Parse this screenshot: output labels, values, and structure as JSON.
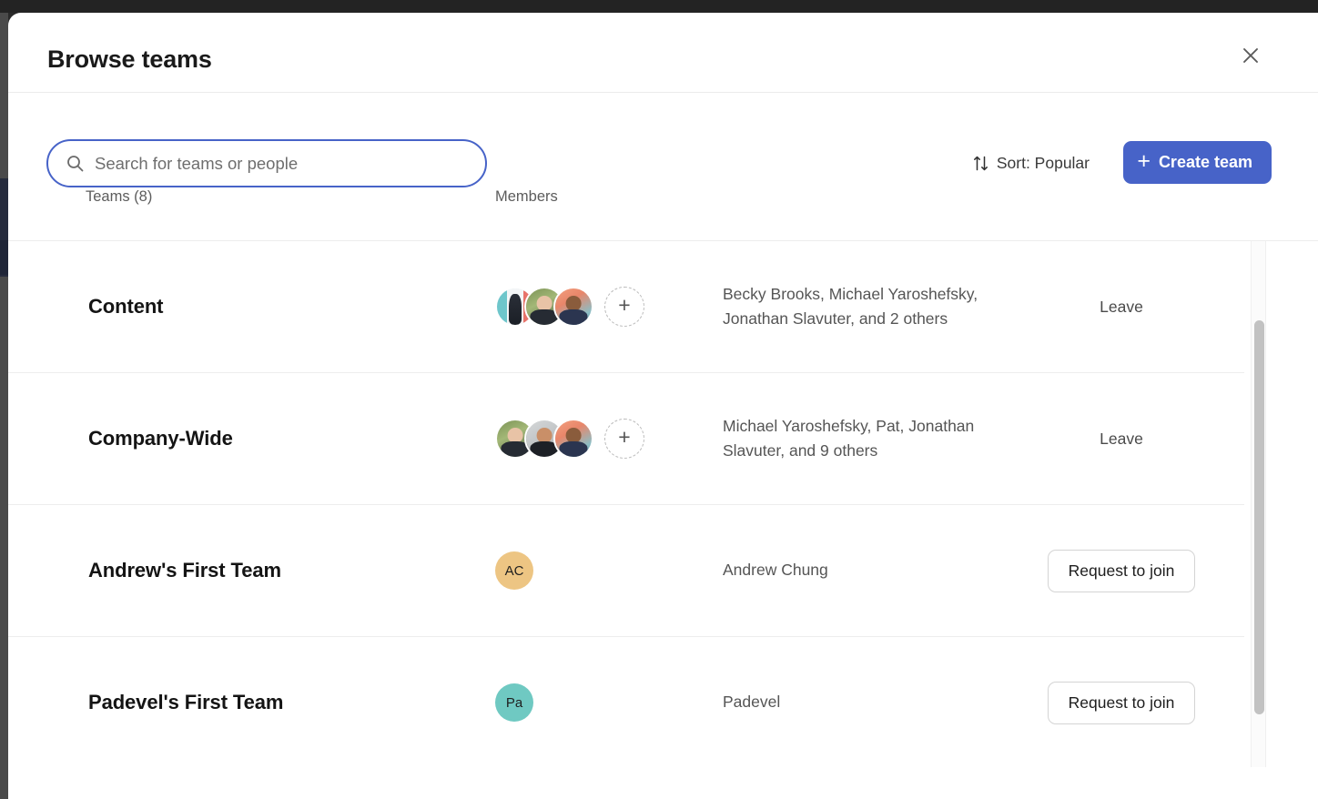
{
  "modal": {
    "title": "Browse teams",
    "close_icon": "close-icon"
  },
  "search": {
    "placeholder": "Search for teams or people",
    "value": "",
    "icon": "search-icon"
  },
  "toolbar": {
    "sort_label": "Sort: Popular",
    "sort_icon": "sort-arrows-icon",
    "create_label": "Create team",
    "create_plus": "+",
    "accent_color": "#4763c8"
  },
  "table": {
    "header_teams": "Teams (8)",
    "header_members": "Members"
  },
  "rows": [
    {
      "name": "Content",
      "members_text": "Becky Brooks, Michael Yaroshefsky, Jonathan Slavuter, and 2 others",
      "action": "Leave",
      "action_type": "leave",
      "avatar_type": "photos",
      "add_member_icon": "plus-icon"
    },
    {
      "name": "Company-Wide",
      "members_text": "Michael Yaroshefsky, Pat, Jonathan Slavuter, and 9 others",
      "action": "Leave",
      "action_type": "leave",
      "avatar_type": "photos",
      "add_member_icon": "plus-icon"
    },
    {
      "name": "Andrew's First Team",
      "members_text": "Andrew Chung",
      "action": "Request to join",
      "action_type": "join",
      "avatar_type": "initials",
      "initials": "AC",
      "initials_color": "#edc583"
    },
    {
      "name": "Padevel's First Team",
      "members_text": "Padevel",
      "action": "Request to join",
      "action_type": "join",
      "avatar_type": "initials",
      "initials": "Pa",
      "initials_color": "#6fc9c2"
    }
  ],
  "scrollbar": {
    "name": "teams-list-scrollbar"
  }
}
